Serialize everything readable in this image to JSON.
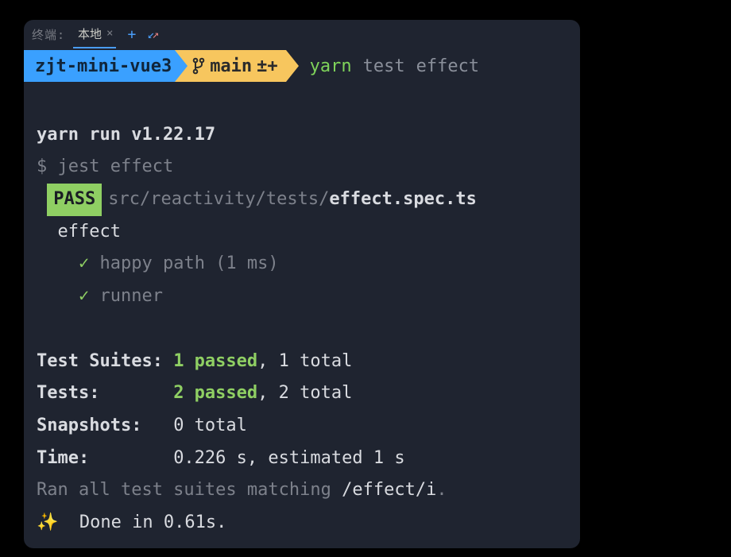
{
  "titlebar": {
    "label": "终端:",
    "tab_name": "本地",
    "close_glyph": "×",
    "plus_glyph": "+"
  },
  "prompt": {
    "project": "zjt-mini-vue3",
    "branch": "main",
    "branch_status": "±+",
    "cmd_yarn": "yarn",
    "cmd_test": "test",
    "cmd_effect": "effect"
  },
  "lines": {
    "yarn_run": "yarn run v1.22.17",
    "dollar": "$ ",
    "jest_cmd": "jest effect",
    "pass_label": "PASS",
    "spec_dir": "src/reactivity/tests/",
    "spec_file": "effect.spec.ts",
    "suite_name": "effect",
    "check_glyph": "✓",
    "test1": "happy path (1 ms)",
    "test2": "runner"
  },
  "summary": {
    "suites_label": "Test Suites: ",
    "suites_passed": "1 passed",
    "suites_total": ", 1 total",
    "tests_label": "Tests:       ",
    "tests_passed": "2 passed",
    "tests_total": ", 2 total",
    "snapshots_label": "Snapshots:   ",
    "snapshots_value": "0 total",
    "time_label": "Time:        ",
    "time_value": "0.226 s, estimated 1 s",
    "ran_prefix": "Ran all test suites matching ",
    "ran_pattern": "/effect/i",
    "ran_suffix": ".",
    "sparkle_glyph": "✨",
    "done": "  Done in 0.61s."
  }
}
